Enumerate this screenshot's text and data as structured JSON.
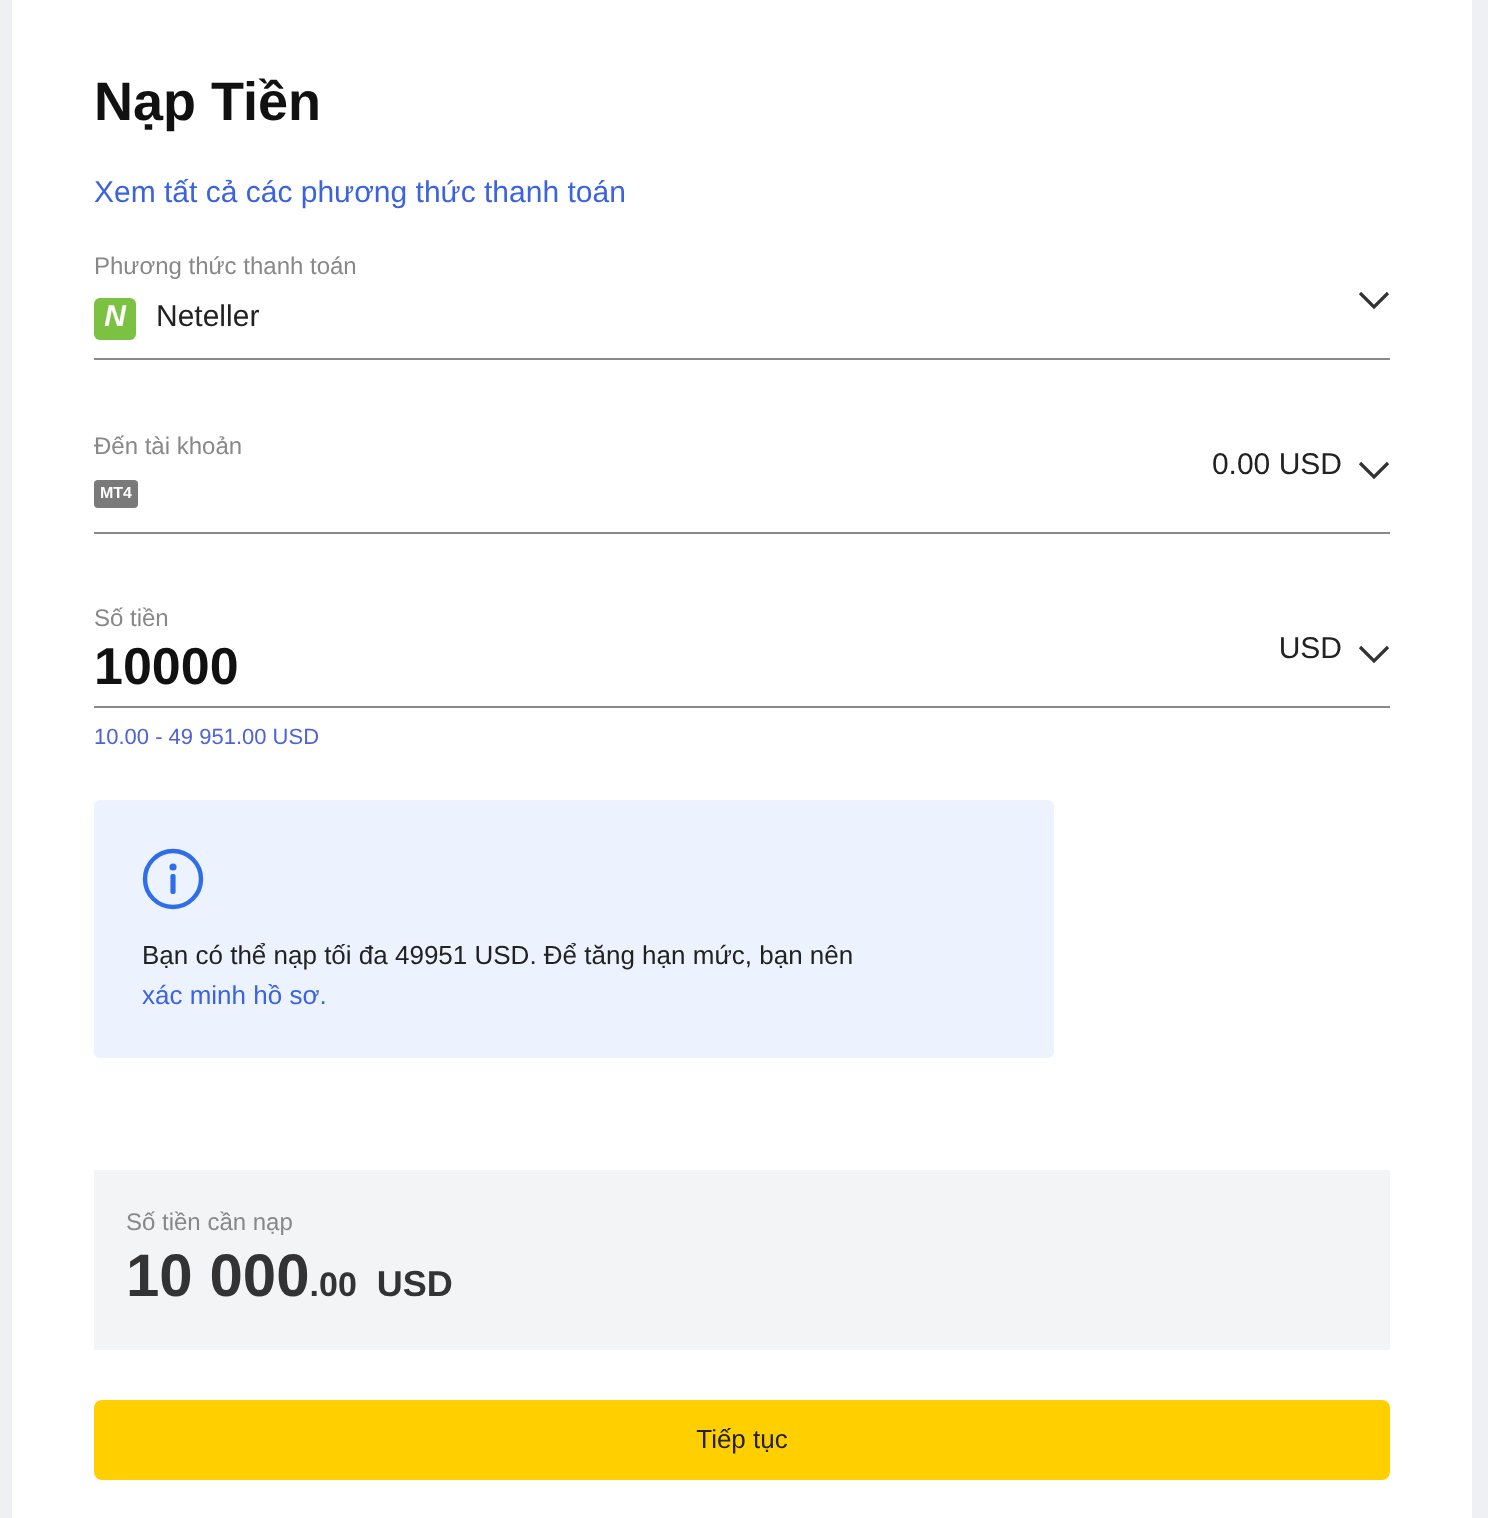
{
  "title": "Nạp Tiền",
  "all_methods_link": "Xem tất cả các phương thức thanh toán",
  "payment_method": {
    "label": "Phương thức thanh toán",
    "logo_text": "N",
    "value": "Neteller"
  },
  "account": {
    "label": "Đến tài khoản",
    "badge": "MT4",
    "balance": "0.00 USD"
  },
  "amount": {
    "label": "Số tiền",
    "value": "10000",
    "currency": "USD",
    "range": "10.00 - 49 951.00 USD"
  },
  "info": {
    "text": "Bạn có thể nạp tối đa 49951 USD. Để tăng hạn mức, bạn nên",
    "link": "xác minh hồ sơ."
  },
  "summary": {
    "label": "Số tiền cần nạp",
    "whole": "10 000",
    "fraction": ".00",
    "currency": "USD"
  },
  "continue_button": "Tiếp tục"
}
